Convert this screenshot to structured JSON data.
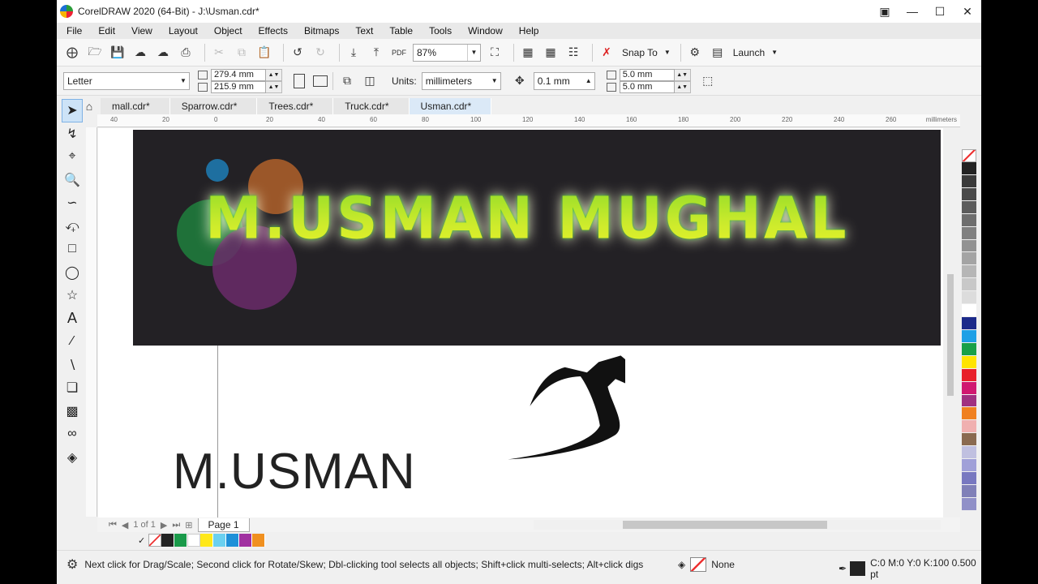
{
  "window": {
    "title": "CorelDRAW 2020 (64-Bit) - J:\\Usman.cdr*"
  },
  "menu": [
    "File",
    "Edit",
    "View",
    "Layout",
    "Object",
    "Effects",
    "Bitmaps",
    "Text",
    "Table",
    "Tools",
    "Window",
    "Help"
  ],
  "toolbar": {
    "zoom": "87%",
    "snap_to": "Snap To",
    "launch": "Launch"
  },
  "properties": {
    "page_size": "Letter",
    "width": "279.4 mm",
    "height": "215.9 mm",
    "units_label": "Units:",
    "units": "millimeters",
    "nudge": "0.1 mm",
    "dup_x": "5.0 mm",
    "dup_y": "5.0 mm"
  },
  "tabs": [
    "mall.cdr*",
    "Sparrow.cdr*",
    "Trees.cdr*",
    "Truck.cdr*",
    "Usman.cdr*"
  ],
  "active_tab": "Usman.cdr*",
  "ruler": {
    "unit": "millimeters",
    "ticks": [
      "40",
      "20",
      "0",
      "20",
      "40",
      "60",
      "80",
      "100",
      "120",
      "140",
      "160",
      "180",
      "200",
      "220",
      "240",
      "260"
    ]
  },
  "canvas": {
    "neon_text": "M.USMAN MUGHAL",
    "plain_text": "M.USMAN",
    "circle_colors": [
      "#1e6fa0",
      "#b0602a",
      "#1f7a3c",
      "#6a2a6a"
    ]
  },
  "pagebar": {
    "page_count": "1 of 1",
    "page_tab": "Page 1"
  },
  "palette": {
    "document": [
      "#232323",
      "#1a9a4a",
      "#ffffff",
      "#ffe81a",
      "#6ad0f0",
      "#1e90d8",
      "#a030a0",
      "#f09020"
    ],
    "default": [
      "#232323",
      "#3a3a3a",
      "#4a4a4a",
      "#5c5c5c",
      "#6e6e6e",
      "#808080",
      "#929292",
      "#a4a4a4",
      "#b6b6b6",
      "#c8c8c8",
      "#dcdcdc",
      "#ffffff",
      "#1c2a8a",
      "#1ea0e6",
      "#18a048",
      "#ffe400",
      "#e8202a",
      "#d01870",
      "#a03080",
      "#f08020",
      "#f0b0b0",
      "#8a6a50",
      "#c0c0e0",
      "#a0a0d8",
      "#7878c0",
      "#8080b8",
      "#9090c8"
    ]
  },
  "status": {
    "hint": "Next click for Drag/Scale; Second click for Rotate/Skew; Dbl-clicking tool selects all objects; Shift+click multi-selects; Alt+click digs",
    "fill": "None",
    "outline": "C:0 M:0 Y:0 K:100  0.500 pt"
  },
  "icons": [
    "select-icon",
    "freehand-pick-icon",
    "crop-icon",
    "zoom-icon",
    "freehand-icon",
    "artistic-media-icon",
    "rectangle-icon",
    "ellipse-icon",
    "polygon-icon",
    "text-icon",
    "parallel-dimension-icon",
    "connector-icon",
    "drop-shadow-icon",
    "transparency-icon",
    "eyedropper-icon",
    "interactive-fill-icon"
  ]
}
